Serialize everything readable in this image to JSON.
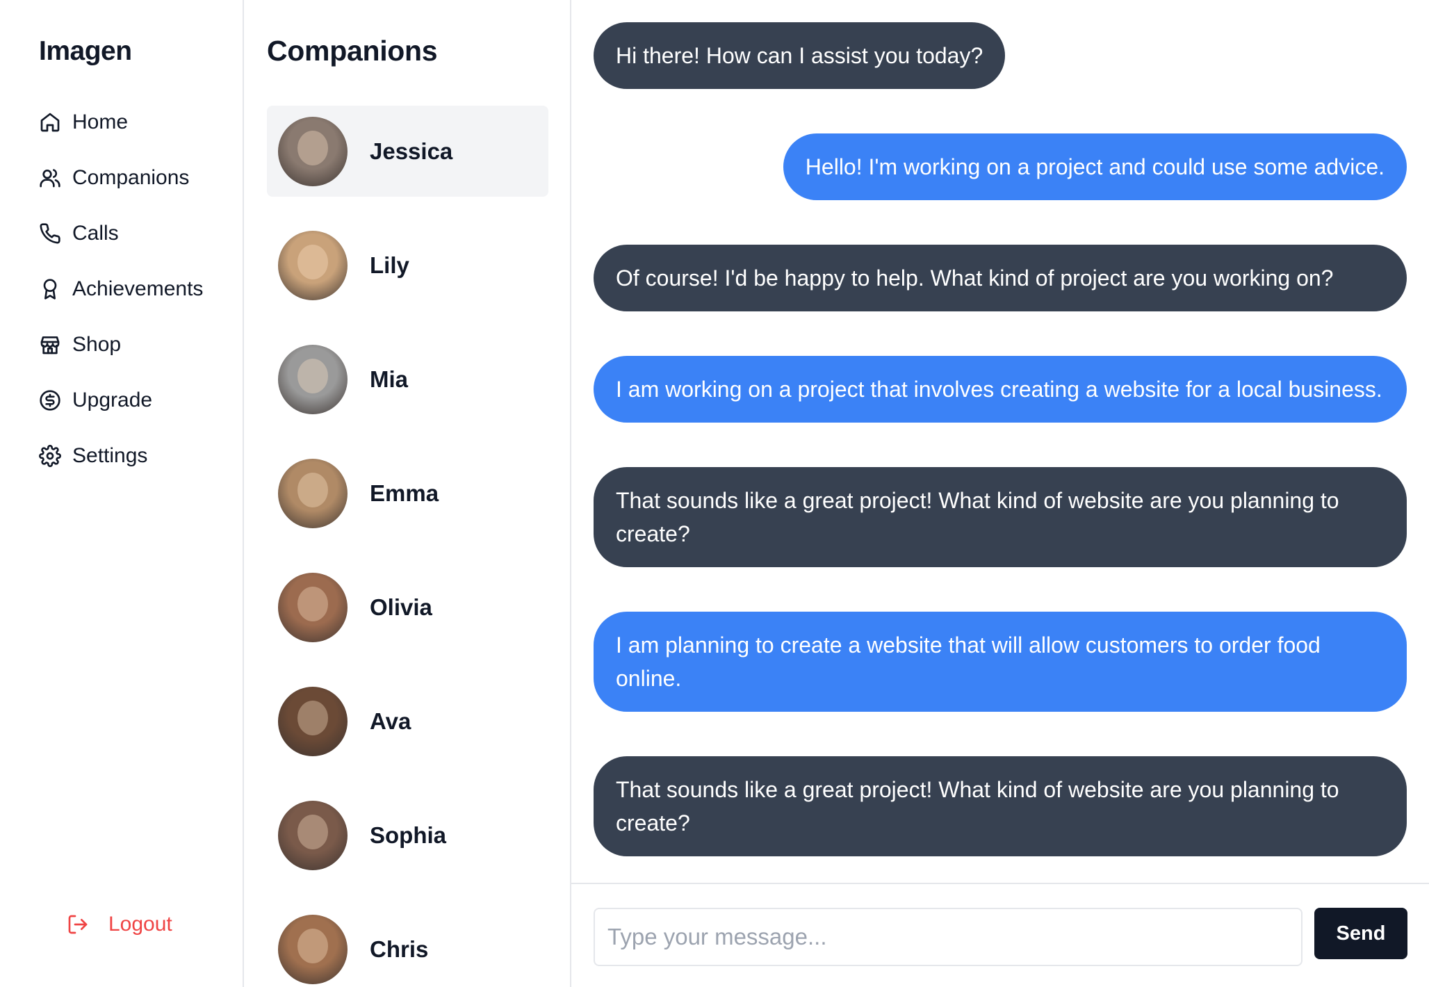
{
  "nav": {
    "brand": "Imagen",
    "items": [
      {
        "label": "Home",
        "icon": "home-icon"
      },
      {
        "label": "Companions",
        "icon": "users-icon"
      },
      {
        "label": "Calls",
        "icon": "phone-icon"
      },
      {
        "label": "Achievements",
        "icon": "award-icon"
      },
      {
        "label": "Shop",
        "icon": "store-icon"
      },
      {
        "label": "Upgrade",
        "icon": "dollar-circle-icon"
      },
      {
        "label": "Settings",
        "icon": "gear-icon"
      }
    ],
    "logout": "Logout"
  },
  "companions": {
    "title": "Companions",
    "selected": "Jessica",
    "items": [
      {
        "name": "Jessica",
        "avatar_color": "#8a7a70"
      },
      {
        "name": "Lily",
        "avatar_color": "#c9a27a"
      },
      {
        "name": "Mia",
        "avatar_color": "#9a9a9a"
      },
      {
        "name": "Emma",
        "avatar_color": "#b08a66"
      },
      {
        "name": "Olivia",
        "avatar_color": "#9c6b4f"
      },
      {
        "name": "Ava",
        "avatar_color": "#6b4a36"
      },
      {
        "name": "Sophia",
        "avatar_color": "#7a5a4a"
      },
      {
        "name": "Chris",
        "avatar_color": "#a0704f"
      }
    ]
  },
  "chat": {
    "messages": [
      {
        "role": "bot",
        "text": "Hi there! How can I assist you today?"
      },
      {
        "role": "user",
        "text": "Hello! I'm working on a project and could use some advice."
      },
      {
        "role": "bot",
        "text": "Of course! I'd be happy to help. What kind of project are you working on?"
      },
      {
        "role": "user",
        "text": "I am working on a project that involves creating a website for a local business."
      },
      {
        "role": "bot",
        "text": "That sounds like a great project! What kind of website are you planning to create?"
      },
      {
        "role": "user",
        "text": "I am planning to create a website that will allow customers to order food online."
      },
      {
        "role": "bot",
        "text": "That sounds like a great project! What kind of website are you planning to create?"
      }
    ],
    "input_placeholder": "Type your message...",
    "input_value": "",
    "send_label": "Send"
  },
  "colors": {
    "bot_bubble": "#374151",
    "user_bubble": "#3b82f6",
    "selected_bg": "#f3f4f6",
    "logout": "#ef4444",
    "send_button": "#111827"
  }
}
